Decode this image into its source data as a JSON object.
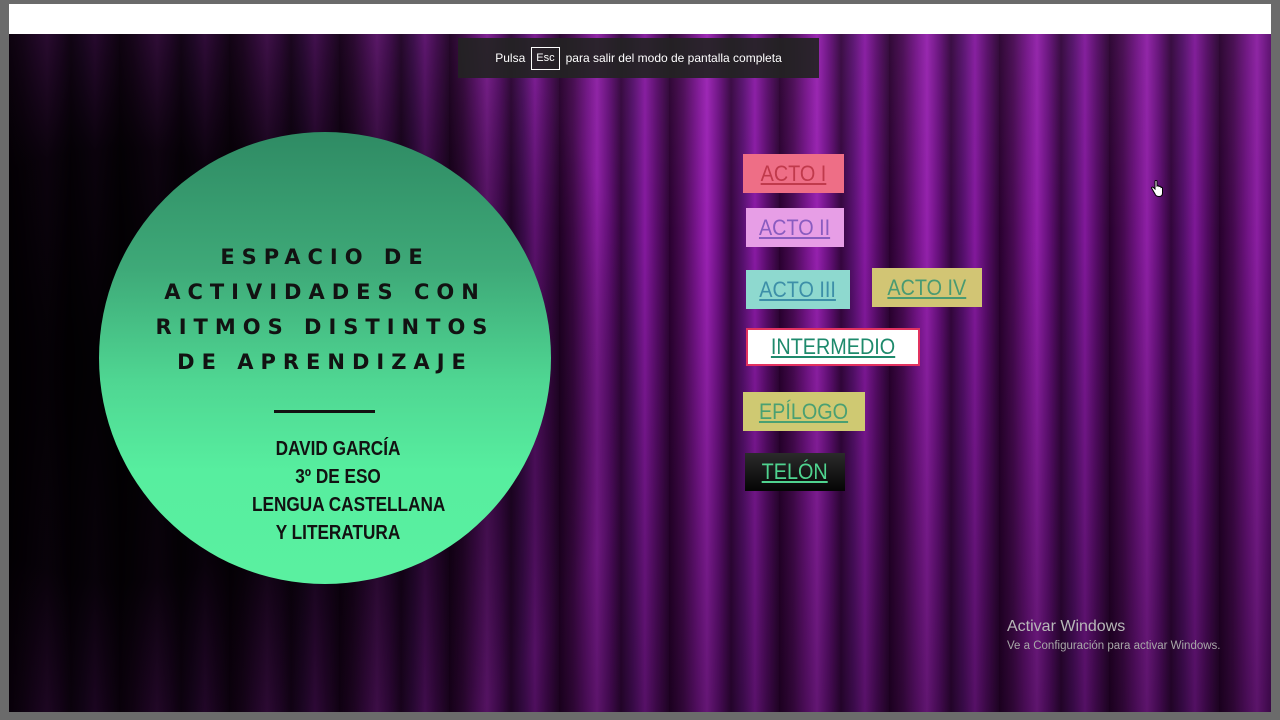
{
  "fullscreen_notice": {
    "prefix": "Pulsa",
    "key": "Esc",
    "suffix": "para salir del modo de pantalla completa"
  },
  "title_circle": {
    "title_lines": [
      "ESPACIO DE",
      "ACTIVIDADES CON",
      "RITMOS DISTINTOS",
      "DE APRENDIZAJE"
    ],
    "info_lines": [
      "DAVID GARCÍA",
      "3º DE ESO",
      "LENGUA CASTELLANA",
      "Y LITERATURA"
    ]
  },
  "menu": {
    "acto_1": "ACTO I",
    "acto_2": "ACTO II",
    "acto_3": "ACTO III",
    "acto_4": "ACTO IV",
    "intermedio": "INTERMEDIO",
    "epilogo": "EPÍLOGO",
    "telon": "TELÓN"
  },
  "watermark": {
    "title": "Activar Windows",
    "subtitle": "Ve a Configuración para activar Windows."
  },
  "colors": {
    "curtain": "#6a1080",
    "circle": "#57ee9f",
    "acto_1_bg": "#ee6e86",
    "acto_2_bg": "#e79ee6",
    "acto_3_bg": "#8ed9cf",
    "acto_4_bg": "#d2c574",
    "intermedio_border": "#e23260",
    "epilogo_bg": "#cfc972",
    "telon_bg": "#050505"
  },
  "icons": {
    "cursor": "hand-pointer-icon"
  }
}
